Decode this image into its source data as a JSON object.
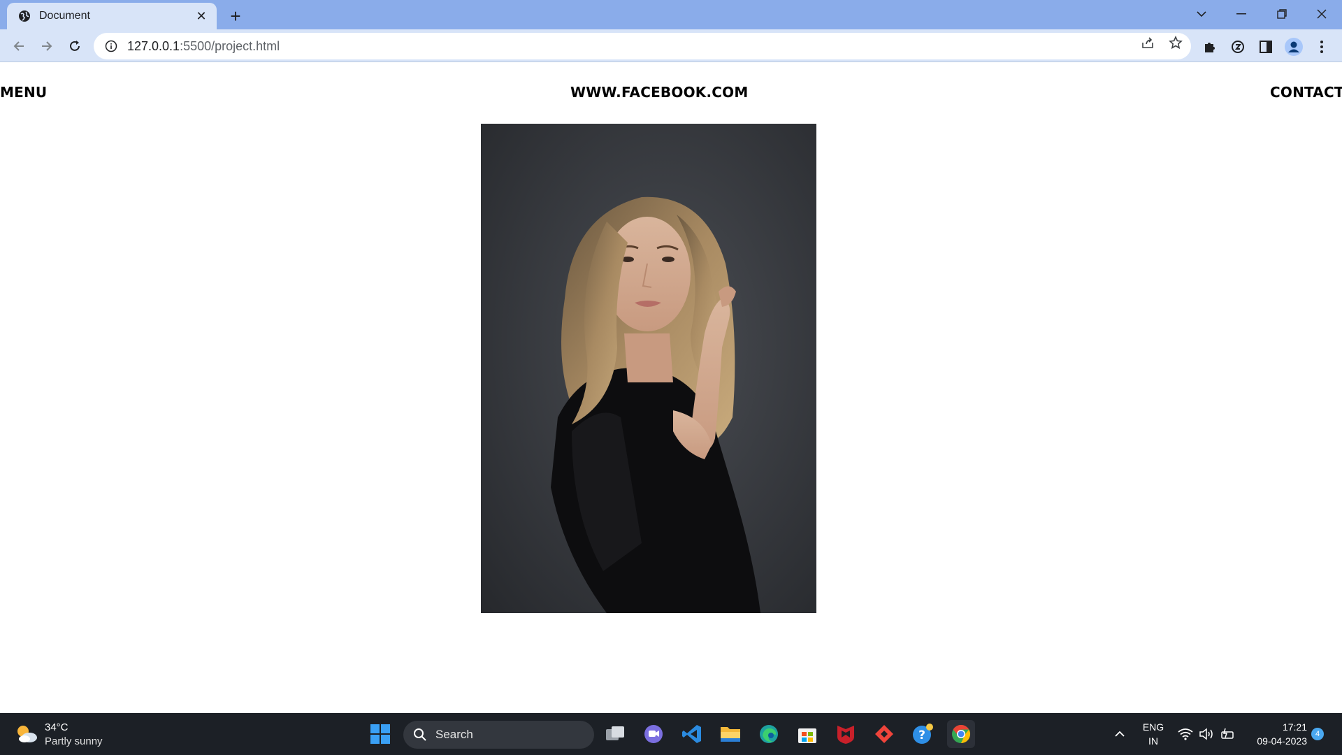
{
  "browser": {
    "tab_title": "Document",
    "url_host": "127.0.0.1",
    "url_rest": ":5500/project.html",
    "icons": {
      "favicon": "globe-icon",
      "close": "close-icon",
      "new_tab": "plus-icon",
      "back": "arrow-left-icon",
      "forward": "arrow-right-icon",
      "reload": "reload-icon",
      "site_info": "info-icon",
      "share": "share-icon",
      "bookmark": "star-icon",
      "extensions": "puzzle-icon",
      "extension2": "extension-icon",
      "side_panel": "side-panel-icon",
      "profile": "avatar-icon",
      "menu": "kebab-menu-icon"
    }
  },
  "page": {
    "menu_label": "MENU",
    "site_label": "WWW.FACEBOOK.COM",
    "contact_label": "CONTACT",
    "photo": "portrait-photo"
  },
  "taskbar": {
    "weather_temp": "34°C",
    "weather_desc": "Partly sunny",
    "search_label": "Search",
    "lang_top": "ENG",
    "lang_bottom": "IN",
    "time": "17:21",
    "date": "09-04-2023",
    "notification_count": "4",
    "apps": [
      "start-icon",
      "task-view-icon",
      "chat-icon",
      "vscode-icon",
      "file-explorer-icon",
      "edge-icon",
      "store-icon",
      "mcafee-icon",
      "anydesk-icon",
      "help-icon",
      "chrome-icon"
    ]
  },
  "colors": {
    "tabbar": "#8aacea",
    "toolbar": "#d8e4f8",
    "taskbar": "#1c2026",
    "photo_bg": "#35383d"
  }
}
